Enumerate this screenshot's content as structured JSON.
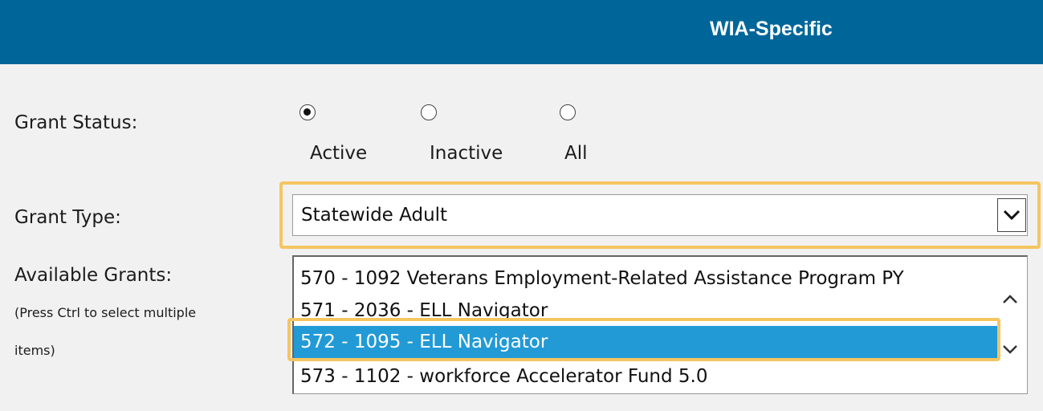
{
  "header": {
    "title": "WIA-Specific"
  },
  "grant_status": {
    "label": "Grant Status:",
    "options": [
      {
        "label": "Active",
        "checked": true
      },
      {
        "label": "Inactive",
        "checked": false
      },
      {
        "label": "All",
        "checked": false
      }
    ]
  },
  "grant_type": {
    "label": "Grant Type:",
    "selected": "Statewide Adult"
  },
  "available_grants": {
    "label": "Available Grants:",
    "hint_line1": "(Press Ctrl to select multiple",
    "hint_line2": "items)",
    "items": [
      {
        "text": "570 - 1092 Veterans Employment-Related Assistance Program PY"
      },
      {
        "text": "571 - 2036 - ELL Navigator"
      },
      {
        "text": "572 - 1095 - ELL Navigator",
        "selected": true
      },
      {
        "text": "573 - 1102 - workforce Accelerator Fund 5.0"
      }
    ]
  },
  "colors": {
    "header_bg": "#006699",
    "highlight_border": "#f4c561",
    "selected_row": "#229ad6"
  }
}
